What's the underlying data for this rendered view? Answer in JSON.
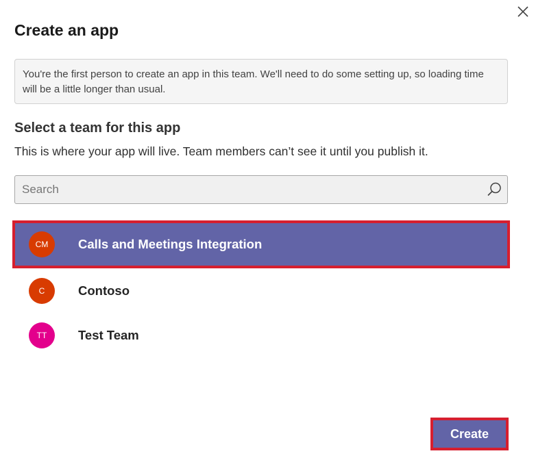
{
  "dialog": {
    "title": "Create an app",
    "close_icon": "close-icon"
  },
  "notice": {
    "text": "You're the first person to create an app in this team. We'll need to do some setting up, so loading time will be a little longer than usual."
  },
  "team_section": {
    "heading": "Select a team for this app",
    "description": "This is where your app will live. Team members can’t see it until you publish it."
  },
  "search": {
    "placeholder": "Search",
    "value": "",
    "icon": "search-icon"
  },
  "teams": [
    {
      "initials": "CM",
      "name": "Calls and Meetings Integration",
      "avatar_color": "#d83b01",
      "selected": true
    },
    {
      "initials": "C",
      "name": "Contoso",
      "avatar_color": "#d83b01",
      "selected": false
    },
    {
      "initials": "TT",
      "name": "Test Team",
      "avatar_color": "#e3008c",
      "selected": false
    }
  ],
  "actions": {
    "create_label": "Create"
  },
  "colors": {
    "accent": "#6264a7",
    "highlight_border": "#d61f2f"
  }
}
